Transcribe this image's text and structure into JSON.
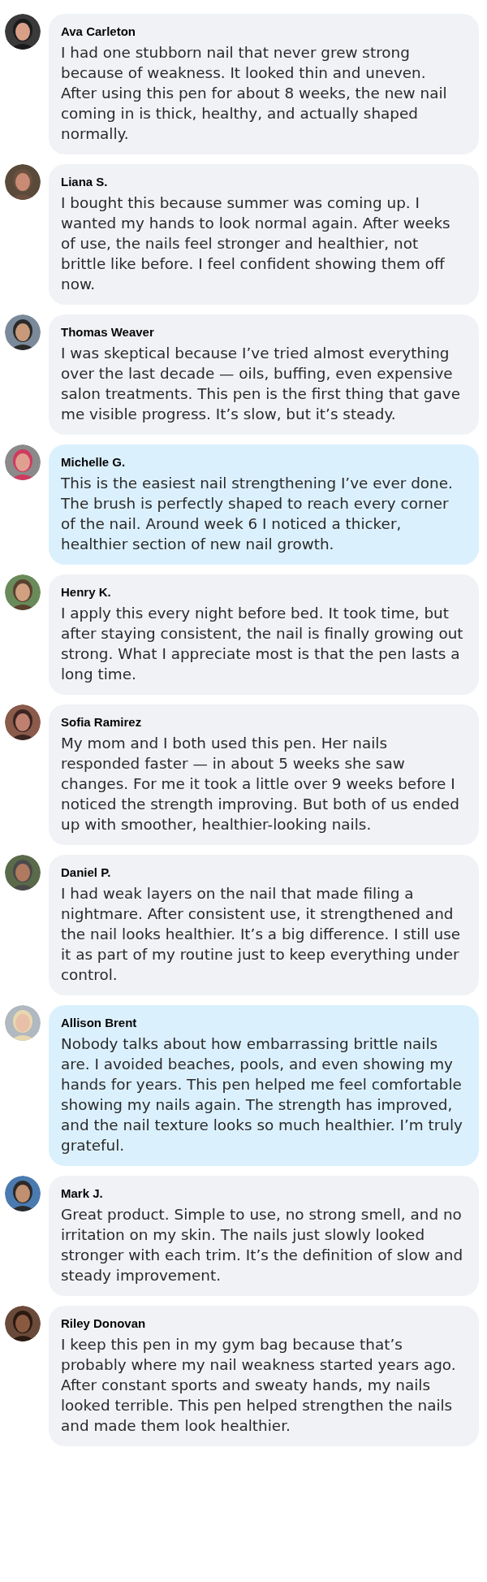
{
  "comments": [
    {
      "author": "Ava Carleton",
      "highlighted": false,
      "text": "I had one stubborn nail that never grew strong because of weakness. It looked thin and uneven. After using this pen for about 8 weeks, the new nail coming in is thick, healthy, and actually shaped normally."
    },
    {
      "author": "Liana S.",
      "highlighted": false,
      "text": "I bought this because summer was coming up. I wanted my hands to look normal again. After weeks of use, the nails feel stronger and healthier, not brittle like before. I feel confident showing them off now."
    },
    {
      "author": "Thomas Weaver",
      "highlighted": false,
      "text": "I was skeptical because I’ve tried almost everything over the last decade — oils, buffing, even expensive salon treatments. This pen is the first thing that gave me visible progress. It’s slow, but it’s steady."
    },
    {
      "author": "Michelle G.",
      "highlighted": true,
      "text": "This is the easiest nail strengthening I’ve ever done. The brush is perfectly shaped to reach every corner of the nail. Around week 6 I noticed a thicker, healthier section of new nail growth."
    },
    {
      "author": "Henry K.",
      "highlighted": false,
      "text": "I apply this every night before bed. It took time, but after staying consistent, the nail is finally growing out strong. What I appreciate most is that the pen lasts a long time."
    },
    {
      "author": "Sofia Ramirez",
      "highlighted": false,
      "text": "My mom and I both used this pen. Her nails responded faster — in about 5 weeks she saw changes. For me it took a little over 9 weeks before I noticed the strength improving. But both of us ended up with smoother, healthier-looking nails."
    },
    {
      "author": "Daniel P.",
      "highlighted": false,
      "text": "I had weak layers on the nail that made filing a nightmare. After consistent use, it strengthened and the nail looks healthier. It’s a big difference. I still use it as part of my routine just to keep everything under control."
    },
    {
      "author": "Allison Brent",
      "highlighted": true,
      "text": "Nobody talks about how embarrassing brittle nails are. I avoided beaches, pools, and even showing my hands for years. This pen helped me feel comfortable showing my nails again. The strength has improved, and the nail texture looks so much healthier. I’m truly grateful."
    },
    {
      "author": "Mark J.",
      "highlighted": false,
      "text": "Great product. Simple to use, no strong smell, and no irritation on my skin. The nails just slowly looked stronger with each trim. It’s the definition of slow and steady improvement."
    },
    {
      "author": "Riley Donovan",
      "highlighted": false,
      "text": "I keep this pen in my gym bag because that’s probably where my nail weakness started years ago. After constant sports and sweaty hands, my nails looked terrible. This pen helped strengthen the nails and made them look healthier."
    }
  ]
}
